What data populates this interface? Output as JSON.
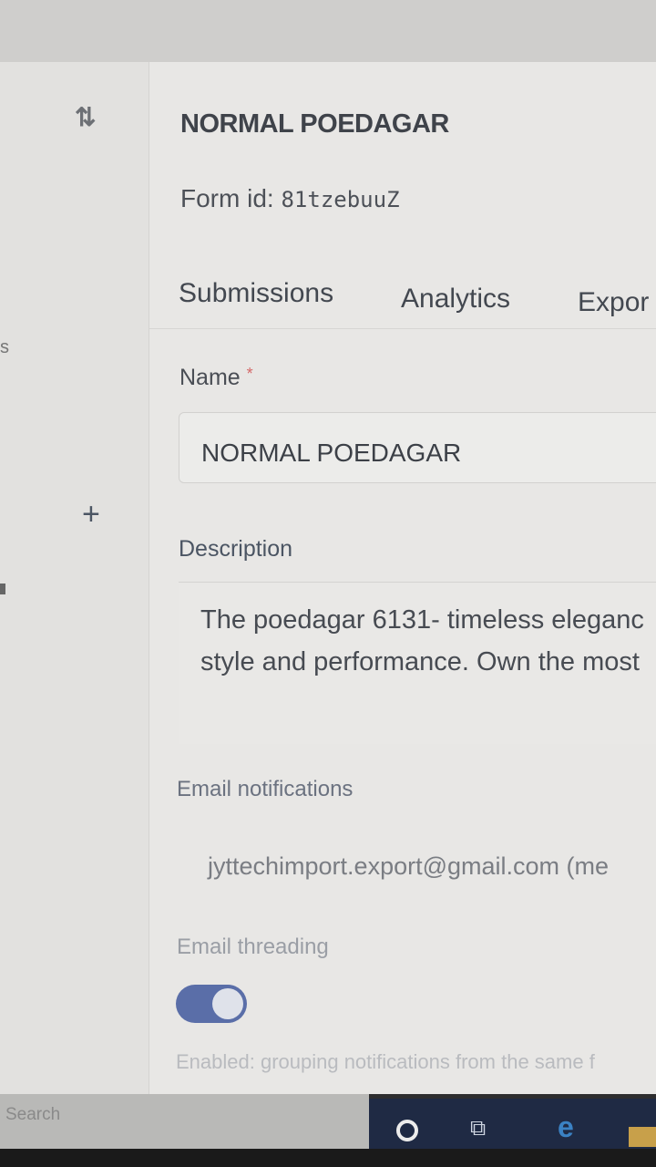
{
  "form": {
    "title": "NORMAL POEDAGAR",
    "id_label": "Form id:",
    "id_value": "81tzebuuZ"
  },
  "tabs": [
    {
      "label": "Submissions"
    },
    {
      "label": "Analytics"
    },
    {
      "label": "Expor"
    }
  ],
  "fields": {
    "name_label": "Name",
    "required_mark": "*",
    "name_value": "NORMAL POEDAGAR",
    "description_label": "Description",
    "description_lines": [
      "The poedagar 6131- timeless eleganc",
      "style and performance. Own the most"
    ],
    "email_notifications_label": "Email notifications",
    "email_value": "jyttechimport.export@gmail.com (me",
    "email_threading_label": "Email threading",
    "email_threading_enabled": true,
    "email_threading_help": "Enabled: grouping notifications from the same f"
  },
  "sidebar": {
    "edge_letter": "s"
  },
  "taskbar": {
    "search_placeholder": "Search"
  },
  "icons": {
    "swap": "swap-icon",
    "add": "plus-icon",
    "cortana": "cortana-icon",
    "task_view": "task-view-icon",
    "edge": "edge-browser-icon",
    "explorer": "folder-icon"
  },
  "colors": {
    "toggle_on": "#5a6ea8",
    "required": "#d46a6a",
    "taskbar": "#1f2a44"
  }
}
